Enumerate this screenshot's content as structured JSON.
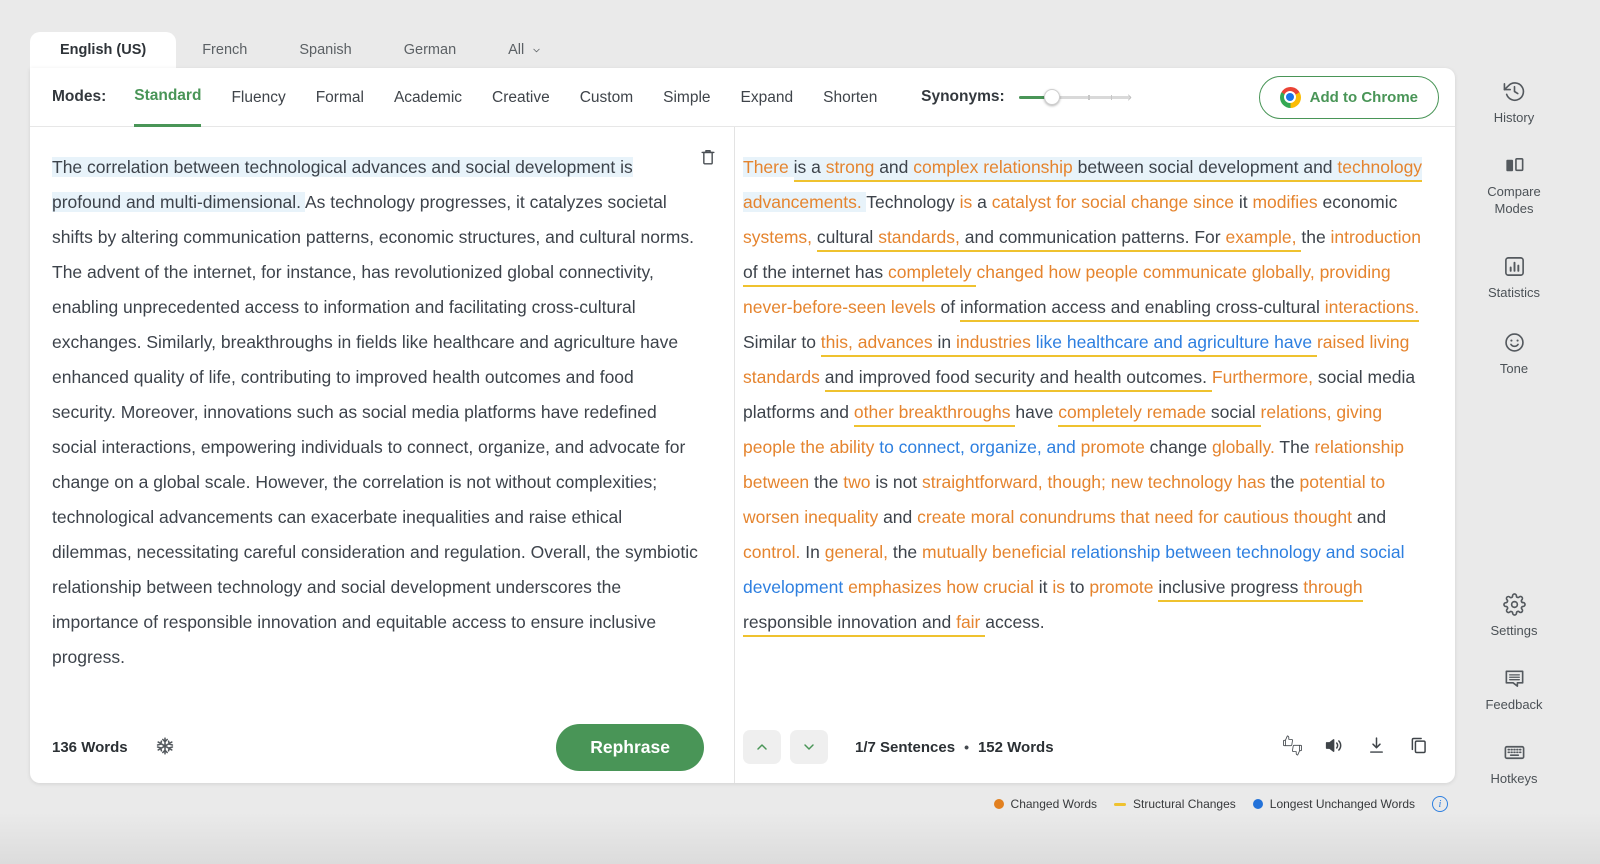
{
  "language_tabs": {
    "items": [
      {
        "label": "English (US)",
        "active": true
      },
      {
        "label": "French"
      },
      {
        "label": "Spanish"
      },
      {
        "label": "German"
      },
      {
        "label": "All",
        "dropdown_icon": "chevron-down-icon"
      }
    ]
  },
  "toolbar": {
    "modes_label": "Modes:",
    "modes": [
      {
        "label": "Standard",
        "active": true
      },
      {
        "label": "Fluency"
      },
      {
        "label": "Formal"
      },
      {
        "label": "Academic"
      },
      {
        "label": "Creative"
      },
      {
        "label": "Custom"
      },
      {
        "label": "Simple"
      },
      {
        "label": "Expand"
      },
      {
        "label": "Shorten"
      }
    ],
    "synonyms": {
      "label": "Synonyms:",
      "value_pct": 30
    },
    "add_to_chrome_label": "Add to Chrome",
    "chrome_icon": "chrome-icon"
  },
  "source_panel": {
    "delete_icon": "trash-icon",
    "freeze_icon": "freeze-words-icon",
    "word_count": "136 Words",
    "rephrase_label": "Rephrase",
    "segments": [
      {
        "t": "The correlation between technological advances and social development is profound and multi-dimensional. ",
        "h": true
      },
      {
        "t": "As technology progresses, it catalyzes societal shifts by altering communication patterns, economic structures, and cultural norms. The advent of the internet, for instance, has revolutionized global connectivity, enabling unprecedented access to information and facilitating cross-cultural exchanges. Similarly, breakthroughs in fields like healthcare and agriculture have enhanced quality of life, contributing to improved health outcomes and food security. Moreover, innovations such as social media platforms have redefined social interactions, empowering individuals to connect, organize, and advocate for change on a global scale. However, the correlation is not without complexities; technological advancements can exacerbate inequalities and raise ethical dilemmas, necessitating careful consideration and regulation. Overall, the symbiotic relationship between technology and social development underscores the importance of responsible innovation and equitable access to ensure inclusive progress."
      }
    ]
  },
  "output_panel": {
    "prev_icon": "chevron-up-icon",
    "next_icon": "chevron-down-icon",
    "sentence_counter": "1/7 Sentences",
    "counter_separator": "•",
    "word_count": "152 Words",
    "action_icons": [
      {
        "name": "thumbs-feedback-icon"
      },
      {
        "name": "read-aloud-icon"
      },
      {
        "name": "download-icon"
      },
      {
        "name": "copy-icon"
      }
    ],
    "segments": [
      {
        "t": "There ",
        "k": "c",
        "h": true
      },
      {
        "t": "is a ",
        "k": "p",
        "u": true,
        "h": true
      },
      {
        "t": "strong ",
        "k": "c",
        "u": true,
        "h": true
      },
      {
        "t": "and ",
        "k": "p",
        "u": true,
        "h": true
      },
      {
        "t": "complex relationship ",
        "k": "c",
        "u": true,
        "h": true
      },
      {
        "t": "between social development and ",
        "k": "p",
        "u": true,
        "h": true
      },
      {
        "t": "technology ",
        "k": "c",
        "u": true,
        "h": true
      },
      {
        "t": "advancements. ",
        "k": "c",
        "h": true
      },
      {
        "t": "Technology ",
        "k": "p"
      },
      {
        "t": "is ",
        "k": "c"
      },
      {
        "t": "a ",
        "k": "p"
      },
      {
        "t": "catalyst for social change since ",
        "k": "c"
      },
      {
        "t": "it ",
        "k": "p"
      },
      {
        "t": "modifies ",
        "k": "c"
      },
      {
        "t": "economic ",
        "k": "p"
      },
      {
        "t": "systems, ",
        "k": "c"
      },
      {
        "t": "cultural ",
        "k": "p",
        "u": true
      },
      {
        "t": "standards, ",
        "k": "c",
        "u": true
      },
      {
        "t": "and communication patterns. ",
        "k": "p",
        "u": true
      },
      {
        "t": "For ",
        "k": "p",
        "u": true
      },
      {
        "t": "example, ",
        "k": "c",
        "u": true
      },
      {
        "t": "the ",
        "k": "p"
      },
      {
        "t": "introduction ",
        "k": "c"
      },
      {
        "t": "of the internet has ",
        "k": "p",
        "u": true
      },
      {
        "t": "completely ",
        "k": "c",
        "u": true
      },
      {
        "t": "changed how people communicate globally, providing never-before-seen levels ",
        "k": "c"
      },
      {
        "t": "of ",
        "k": "p"
      },
      {
        "t": "information access and enabling cross-cultural ",
        "k": "p",
        "u": true
      },
      {
        "t": "interactions. ",
        "k": "c",
        "u": true
      },
      {
        "t": "Similar to ",
        "k": "p"
      },
      {
        "t": "this, advances ",
        "k": "c",
        "u": true
      },
      {
        "t": "in ",
        "k": "p",
        "u": true
      },
      {
        "t": "industries ",
        "k": "c",
        "u": true
      },
      {
        "t": "like healthcare and agriculture have ",
        "k": "l",
        "u": true
      },
      {
        "t": "raised living standards ",
        "k": "c"
      },
      {
        "t": "and improved food security and health outcomes. ",
        "k": "p",
        "u": true
      },
      {
        "t": "Furthermore, ",
        "k": "c"
      },
      {
        "t": "social media platforms and ",
        "k": "p"
      },
      {
        "t": "other breakthroughs ",
        "k": "c",
        "u": true
      },
      {
        "t": "have ",
        "k": "p"
      },
      {
        "t": "completely remade ",
        "k": "c",
        "u": true
      },
      {
        "t": "social ",
        "k": "p",
        "u": true
      },
      {
        "t": "relations, giving people the ability ",
        "k": "c"
      },
      {
        "t": "to connect, organize, and ",
        "k": "l"
      },
      {
        "t": "promote ",
        "k": "c"
      },
      {
        "t": "change ",
        "k": "p"
      },
      {
        "t": "globally. ",
        "k": "c"
      },
      {
        "t": "The ",
        "k": "p"
      },
      {
        "t": "relationship between ",
        "k": "c"
      },
      {
        "t": "the ",
        "k": "p"
      },
      {
        "t": "two ",
        "k": "c"
      },
      {
        "t": "is not ",
        "k": "p"
      },
      {
        "t": "straightforward, though; new technology has ",
        "k": "c"
      },
      {
        "t": "the ",
        "k": "p"
      },
      {
        "t": "potential to worsen inequality ",
        "k": "c"
      },
      {
        "t": "and ",
        "k": "p"
      },
      {
        "t": "create moral conundrums that need for cautious thought ",
        "k": "c"
      },
      {
        "t": "and ",
        "k": "p"
      },
      {
        "t": "control. ",
        "k": "c"
      },
      {
        "t": "In ",
        "k": "p"
      },
      {
        "t": "general, ",
        "k": "c"
      },
      {
        "t": "the ",
        "k": "p"
      },
      {
        "t": "mutually beneficial ",
        "k": "c"
      },
      {
        "t": "relationship between technology and social development ",
        "k": "l"
      },
      {
        "t": "emphasizes how crucial ",
        "k": "c"
      },
      {
        "t": "it ",
        "k": "p"
      },
      {
        "t": "is ",
        "k": "c"
      },
      {
        "t": "to ",
        "k": "p"
      },
      {
        "t": "promote ",
        "k": "c"
      },
      {
        "t": "inclusive progress ",
        "k": "p",
        "u": true
      },
      {
        "t": "through ",
        "k": "c",
        "u": true
      },
      {
        "t": "responsible innovation and ",
        "k": "p",
        "u": true
      },
      {
        "t": "fair ",
        "k": "c",
        "u": true
      },
      {
        "t": "access.",
        "k": "p"
      }
    ]
  },
  "legend": {
    "items": [
      {
        "label": "Changed Words",
        "marker": "dot",
        "color": "#e2801f"
      },
      {
        "label": "Structural Changes",
        "marker": "dash",
        "color": "#efc22f"
      },
      {
        "label": "Longest Unchanged Words",
        "marker": "dot",
        "color": "#2372d9"
      }
    ],
    "info_icon": "info-icon"
  },
  "sidebar": {
    "items": [
      {
        "label": "History",
        "icon": "history-icon"
      },
      {
        "label": "Compare Modes",
        "icon": "compare-modes-icon"
      },
      {
        "label": "Statistics",
        "icon": "statistics-icon"
      },
      {
        "label": "Tone",
        "icon": "tone-icon"
      },
      {
        "label": "Settings",
        "icon": "settings-icon"
      },
      {
        "label": "Feedback",
        "icon": "feedback-icon"
      },
      {
        "label": "Hotkeys",
        "icon": "hotkeys-icon"
      }
    ]
  },
  "colors": {
    "accent_green": "#499557",
    "changed_words": "#e5842e",
    "structural_changes": "#efc22f",
    "longest_unchanged": "#2d7fe0",
    "sentence_highlight": "#e8f3fa",
    "text_dark": "#3d434b"
  }
}
